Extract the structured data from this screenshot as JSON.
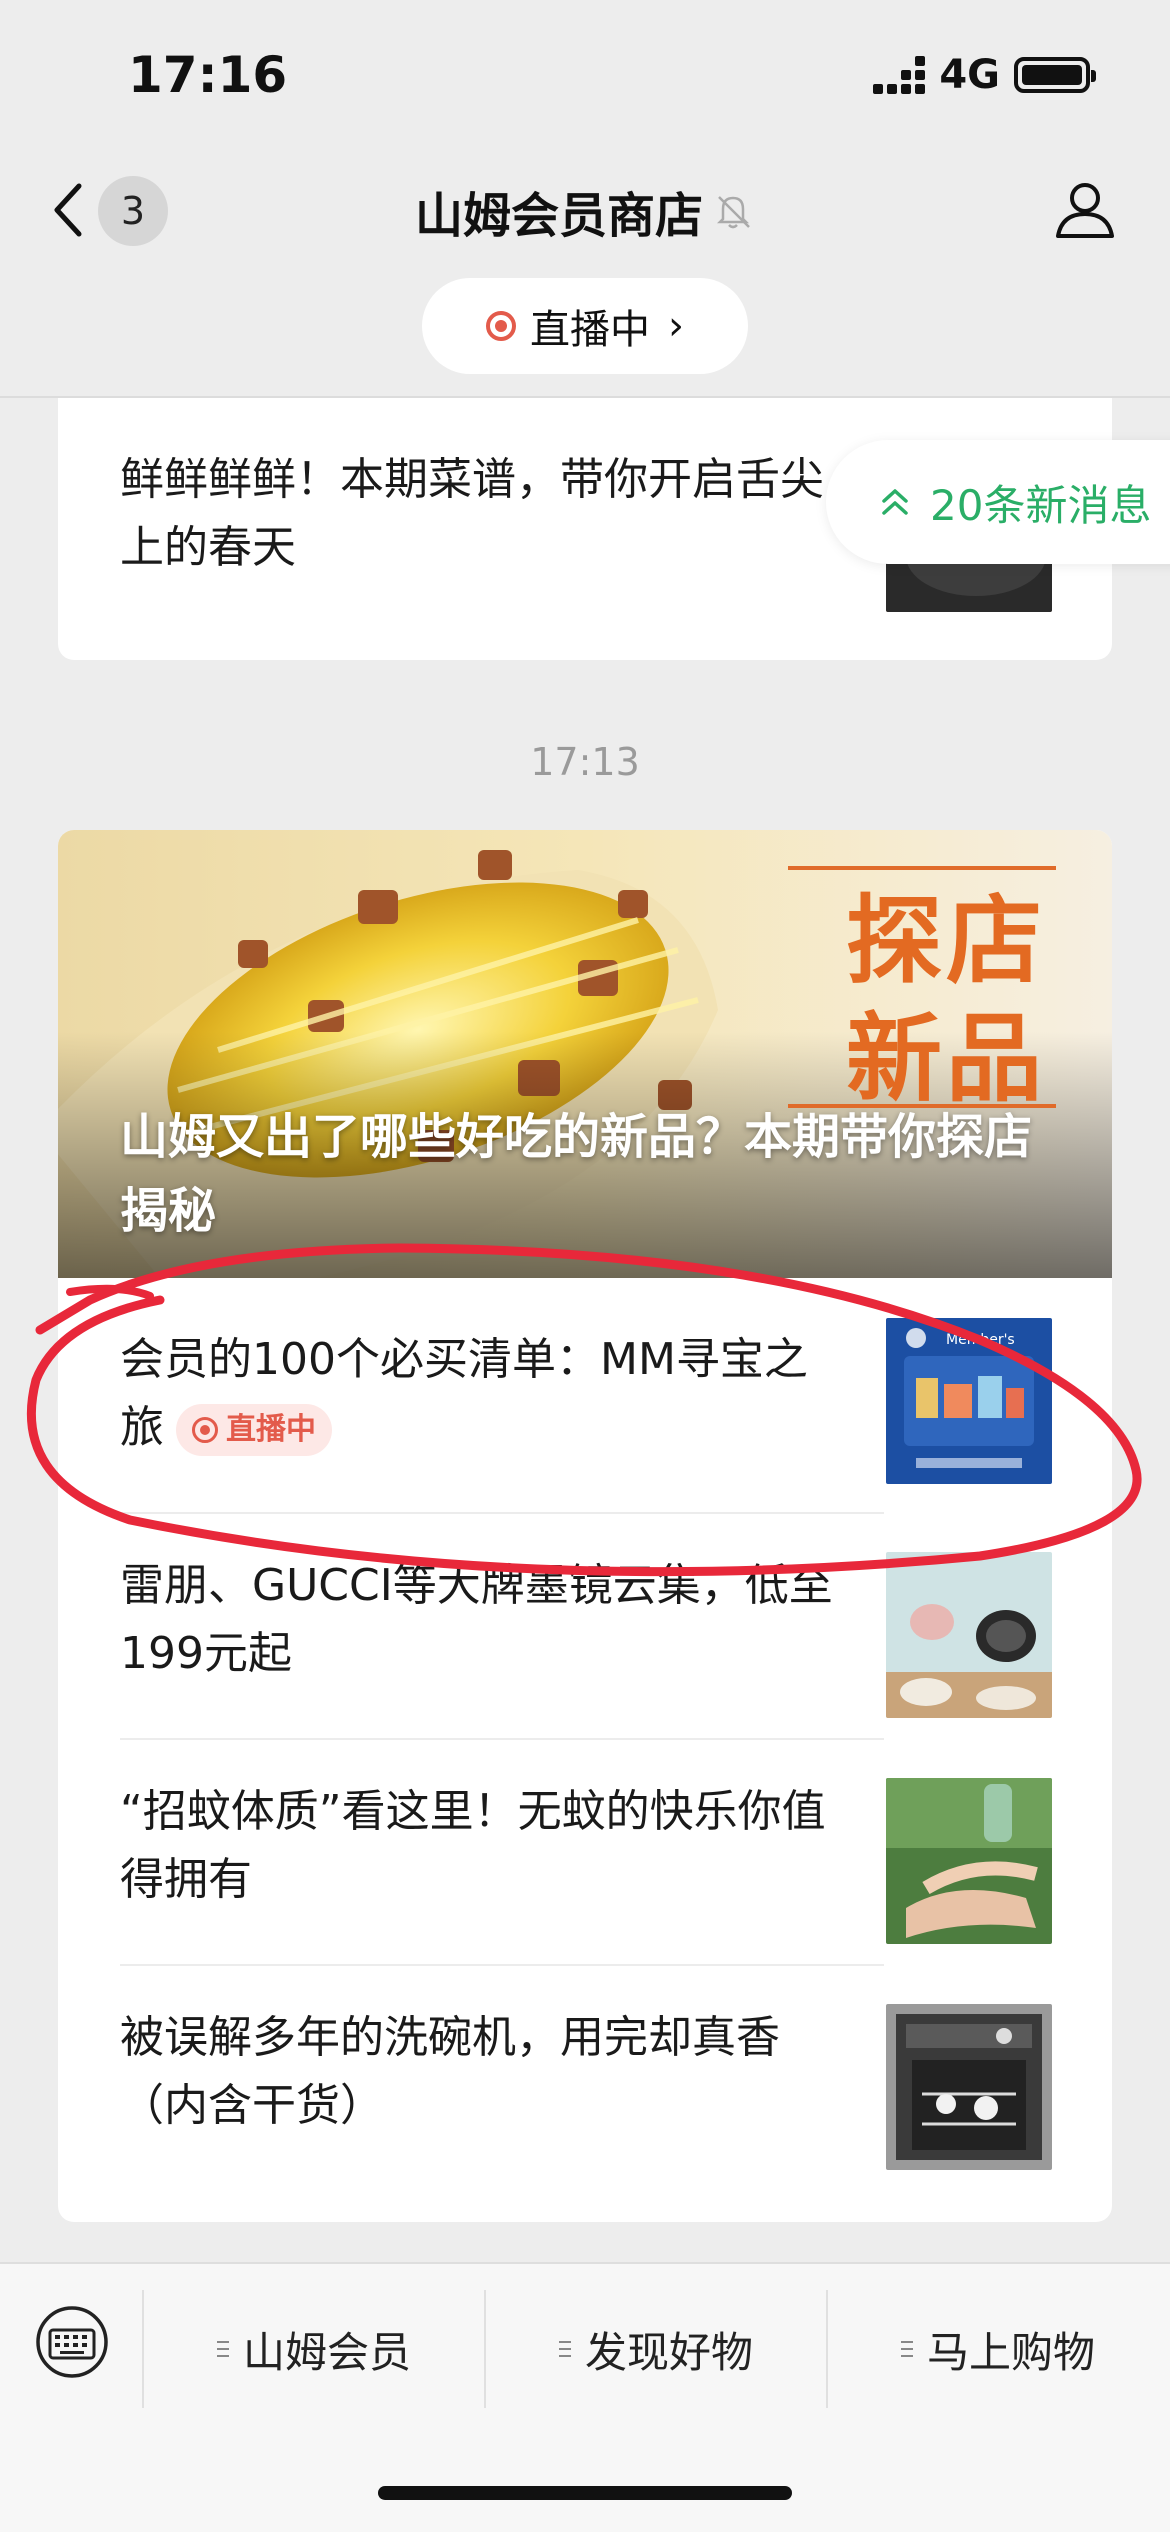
{
  "status_bar": {
    "time": "17:16",
    "network": "4G"
  },
  "nav": {
    "unread_count": "3",
    "title": "山姆会员商店",
    "live_pill_label": "直播中"
  },
  "new_messages_label": "20条新消息",
  "top_card": {
    "article_title": "鲜鲜鲜鲜！本期菜谱，带你开启舌尖上的春天"
  },
  "timestamp": "17:13",
  "main_card": {
    "hero_title": "山姆又出了哪些好吃的新品？本期带你探店揭秘",
    "hero_badge": [
      "探店",
      "新品"
    ],
    "articles": [
      {
        "title": "会员的100个必买清单：MM寻宝之旅",
        "live_tag": "直播中",
        "thumb_label": "Member's"
      },
      {
        "title": "雷朋、GUCCI等大牌墨镜云集，低至199元起"
      },
      {
        "title": "“招蚊体质”看这里！无蚊的快乐你值得拥有"
      },
      {
        "title": "被误解多年的洗碗机，用完却真香（内含干货）"
      }
    ]
  },
  "bottom_menu": {
    "items": [
      "山姆会员",
      "发现好物",
      "马上购物"
    ]
  },
  "colors": {
    "accent_green": "#2aae67",
    "live_red": "#e35b4b",
    "annotation_red": "#e8283a",
    "badge_orange": "#e36a22"
  }
}
